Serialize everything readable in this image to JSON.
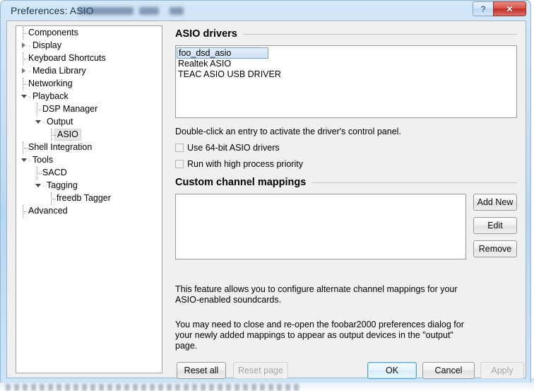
{
  "window": {
    "title": "Preferences: ASIO",
    "help_button": "?",
    "close_button": "✕"
  },
  "sidebar": {
    "items": [
      {
        "label": "Components",
        "indent": 0,
        "glyph": "leaf",
        "selected": false
      },
      {
        "label": "Display",
        "indent": 0,
        "glyph": "closed",
        "selected": false
      },
      {
        "label": "Keyboard Shortcuts",
        "indent": 0,
        "glyph": "leaf",
        "selected": false
      },
      {
        "label": "Media Library",
        "indent": 0,
        "glyph": "closed",
        "selected": false
      },
      {
        "label": "Networking",
        "indent": 0,
        "glyph": "leaf",
        "selected": false
      },
      {
        "label": "Playback",
        "indent": 0,
        "glyph": "open",
        "selected": false
      },
      {
        "label": "DSP Manager",
        "indent": 1,
        "glyph": "leaf",
        "selected": false
      },
      {
        "label": "Output",
        "indent": 1,
        "glyph": "open",
        "selected": false
      },
      {
        "label": "ASIO",
        "indent": 2,
        "glyph": "leaf",
        "selected": true
      },
      {
        "label": "Shell Integration",
        "indent": 0,
        "glyph": "leaf",
        "selected": false
      },
      {
        "label": "Tools",
        "indent": 0,
        "glyph": "open",
        "selected": false
      },
      {
        "label": "SACD",
        "indent": 1,
        "glyph": "leaf",
        "selected": false
      },
      {
        "label": "Tagging",
        "indent": 1,
        "glyph": "open",
        "selected": false
      },
      {
        "label": "freedb Tagger",
        "indent": 2,
        "glyph": "leaf",
        "selected": false
      },
      {
        "label": "Advanced",
        "indent": 0,
        "glyph": "leaf",
        "selected": false
      }
    ]
  },
  "drivers_group": {
    "title": "ASIO drivers",
    "items": [
      {
        "label": "foo_dsd_asio",
        "selected": true
      },
      {
        "label": "Realtek ASIO",
        "selected": false
      },
      {
        "label": "TEAC ASIO USB DRIVER",
        "selected": false
      }
    ],
    "hint": "Double-click an entry to activate the driver's control panel.",
    "checkboxes": [
      {
        "label": "Use 64-bit ASIO drivers",
        "checked": false
      },
      {
        "label": "Run with high process priority",
        "checked": false
      }
    ]
  },
  "mappings_group": {
    "title": "Custom channel mappings",
    "items": [],
    "buttons": [
      {
        "label": "Add New",
        "disabled": false
      },
      {
        "label": "Edit",
        "disabled": false
      },
      {
        "label": "Remove",
        "disabled": false
      }
    ],
    "paragraph_1": "This feature allows you to configure alternate channel mappings for your ASIO-enabled soundcards.",
    "paragraph_2": "You may need to close and re-open the foobar2000 preferences dialog for your newly added mappings to appear as output devices in the \"output\" page."
  },
  "footer": {
    "reset_all": "Reset all",
    "reset_page": "Reset page",
    "ok": "OK",
    "cancel": "Cancel",
    "apply": "Apply"
  },
  "colors": {
    "aero_frame": "#c3dcf2",
    "close_red": "#d9544a",
    "selection_blue": "#cfe2f5",
    "default_focus": "#4ea2c9"
  }
}
